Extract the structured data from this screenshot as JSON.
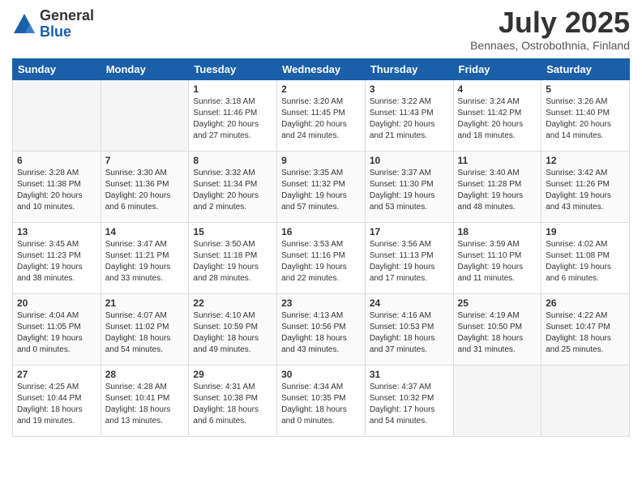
{
  "logo": {
    "general": "General",
    "blue": "Blue"
  },
  "title": {
    "month": "July 2025",
    "location": "Bennaes, Ostrobothnia, Finland"
  },
  "weekdays": [
    "Sunday",
    "Monday",
    "Tuesday",
    "Wednesday",
    "Thursday",
    "Friday",
    "Saturday"
  ],
  "weeks": [
    [
      {
        "day": "",
        "info": ""
      },
      {
        "day": "",
        "info": ""
      },
      {
        "day": "1",
        "info": "Sunrise: 3:18 AM\nSunset: 11:46 PM\nDaylight: 20 hours\nand 27 minutes."
      },
      {
        "day": "2",
        "info": "Sunrise: 3:20 AM\nSunset: 11:45 PM\nDaylight: 20 hours\nand 24 minutes."
      },
      {
        "day": "3",
        "info": "Sunrise: 3:22 AM\nSunset: 11:43 PM\nDaylight: 20 hours\nand 21 minutes."
      },
      {
        "day": "4",
        "info": "Sunrise: 3:24 AM\nSunset: 11:42 PM\nDaylight: 20 hours\nand 18 minutes."
      },
      {
        "day": "5",
        "info": "Sunrise: 3:26 AM\nSunset: 11:40 PM\nDaylight: 20 hours\nand 14 minutes."
      }
    ],
    [
      {
        "day": "6",
        "info": "Sunrise: 3:28 AM\nSunset: 11:38 PM\nDaylight: 20 hours\nand 10 minutes."
      },
      {
        "day": "7",
        "info": "Sunrise: 3:30 AM\nSunset: 11:36 PM\nDaylight: 20 hours\nand 6 minutes."
      },
      {
        "day": "8",
        "info": "Sunrise: 3:32 AM\nSunset: 11:34 PM\nDaylight: 20 hours\nand 2 minutes."
      },
      {
        "day": "9",
        "info": "Sunrise: 3:35 AM\nSunset: 11:32 PM\nDaylight: 19 hours\nand 57 minutes."
      },
      {
        "day": "10",
        "info": "Sunrise: 3:37 AM\nSunset: 11:30 PM\nDaylight: 19 hours\nand 53 minutes."
      },
      {
        "day": "11",
        "info": "Sunrise: 3:40 AM\nSunset: 11:28 PM\nDaylight: 19 hours\nand 48 minutes."
      },
      {
        "day": "12",
        "info": "Sunrise: 3:42 AM\nSunset: 11:26 PM\nDaylight: 19 hours\nand 43 minutes."
      }
    ],
    [
      {
        "day": "13",
        "info": "Sunrise: 3:45 AM\nSunset: 11:23 PM\nDaylight: 19 hours\nand 38 minutes."
      },
      {
        "day": "14",
        "info": "Sunrise: 3:47 AM\nSunset: 11:21 PM\nDaylight: 19 hours\nand 33 minutes."
      },
      {
        "day": "15",
        "info": "Sunrise: 3:50 AM\nSunset: 11:18 PM\nDaylight: 19 hours\nand 28 minutes."
      },
      {
        "day": "16",
        "info": "Sunrise: 3:53 AM\nSunset: 11:16 PM\nDaylight: 19 hours\nand 22 minutes."
      },
      {
        "day": "17",
        "info": "Sunrise: 3:56 AM\nSunset: 11:13 PM\nDaylight: 19 hours\nand 17 minutes."
      },
      {
        "day": "18",
        "info": "Sunrise: 3:59 AM\nSunset: 11:10 PM\nDaylight: 19 hours\nand 11 minutes."
      },
      {
        "day": "19",
        "info": "Sunrise: 4:02 AM\nSunset: 11:08 PM\nDaylight: 19 hours\nand 6 minutes."
      }
    ],
    [
      {
        "day": "20",
        "info": "Sunrise: 4:04 AM\nSunset: 11:05 PM\nDaylight: 19 hours\nand 0 minutes."
      },
      {
        "day": "21",
        "info": "Sunrise: 4:07 AM\nSunset: 11:02 PM\nDaylight: 18 hours\nand 54 minutes."
      },
      {
        "day": "22",
        "info": "Sunrise: 4:10 AM\nSunset: 10:59 PM\nDaylight: 18 hours\nand 49 minutes."
      },
      {
        "day": "23",
        "info": "Sunrise: 4:13 AM\nSunset: 10:56 PM\nDaylight: 18 hours\nand 43 minutes."
      },
      {
        "day": "24",
        "info": "Sunrise: 4:16 AM\nSunset: 10:53 PM\nDaylight: 18 hours\nand 37 minutes."
      },
      {
        "day": "25",
        "info": "Sunrise: 4:19 AM\nSunset: 10:50 PM\nDaylight: 18 hours\nand 31 minutes."
      },
      {
        "day": "26",
        "info": "Sunrise: 4:22 AM\nSunset: 10:47 PM\nDaylight: 18 hours\nand 25 minutes."
      }
    ],
    [
      {
        "day": "27",
        "info": "Sunrise: 4:25 AM\nSunset: 10:44 PM\nDaylight: 18 hours\nand 19 minutes."
      },
      {
        "day": "28",
        "info": "Sunrise: 4:28 AM\nSunset: 10:41 PM\nDaylight: 18 hours\nand 13 minutes."
      },
      {
        "day": "29",
        "info": "Sunrise: 4:31 AM\nSunset: 10:38 PM\nDaylight: 18 hours\nand 6 minutes."
      },
      {
        "day": "30",
        "info": "Sunrise: 4:34 AM\nSunset: 10:35 PM\nDaylight: 18 hours\nand 0 minutes."
      },
      {
        "day": "31",
        "info": "Sunrise: 4:37 AM\nSunset: 10:32 PM\nDaylight: 17 hours\nand 54 minutes."
      },
      {
        "day": "",
        "info": ""
      },
      {
        "day": "",
        "info": ""
      }
    ]
  ]
}
